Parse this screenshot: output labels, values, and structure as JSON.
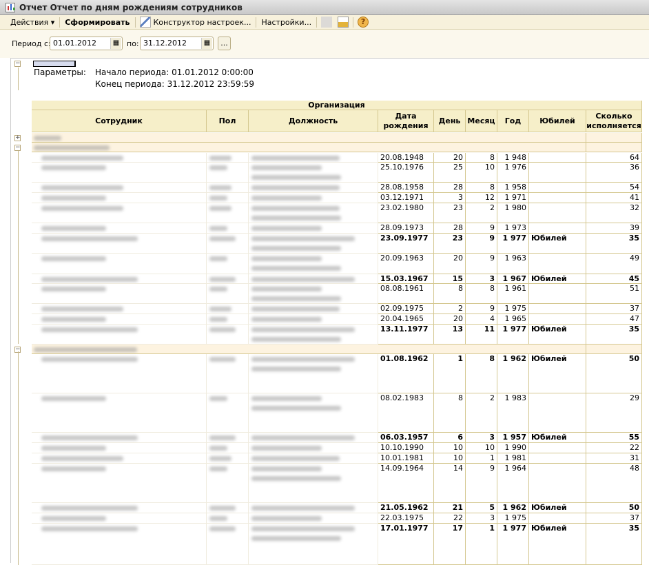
{
  "window": {
    "title": "Отчет  Отчет по дням рождениям сотрудников"
  },
  "toolbar": {
    "actions": "Действия ▾",
    "generate": "Сформировать",
    "constructor": "Конструктор настроек...",
    "settings": "Настройки...",
    "help": "?"
  },
  "period": {
    "from_label": "Период с:",
    "from_value": "01.01.2012",
    "to_label": "по:",
    "to_value": "31.12.2012",
    "more": "..."
  },
  "params": {
    "label": "Параметры:",
    "start": "Начало периода: 01.01.2012 0:00:00",
    "end": "Конец периода: 31.12.2012 23:59:59"
  },
  "table": {
    "group_header": "Организация",
    "columns": [
      "Сотрудник",
      "Пол",
      "Должность",
      "Дата рождения",
      "День",
      "Месяц",
      "Год",
      "Юбилей",
      "Сколько исполняется"
    ],
    "rows": [
      {
        "date": "20.08.1948",
        "day": "20",
        "month": "8",
        "year": "1 948",
        "jubilee": "",
        "age": "64",
        "bold": false
      },
      {
        "date": "25.10.1976",
        "day": "25",
        "month": "10",
        "year": "1 976",
        "jubilee": "",
        "age": "36",
        "bold": false
      },
      {
        "date": "28.08.1958",
        "day": "28",
        "month": "8",
        "year": "1 958",
        "jubilee": "",
        "age": "54",
        "bold": false
      },
      {
        "date": "03.12.1971",
        "day": "3",
        "month": "12",
        "year": "1 971",
        "jubilee": "",
        "age": "41",
        "bold": false
      },
      {
        "date": "23.02.1980",
        "day": "23",
        "month": "2",
        "year": "1 980",
        "jubilee": "",
        "age": "32",
        "bold": false
      },
      {
        "date": "28.09.1973",
        "day": "28",
        "month": "9",
        "year": "1 973",
        "jubilee": "",
        "age": "39",
        "bold": false
      },
      {
        "date": "23.09.1977",
        "day": "23",
        "month": "9",
        "year": "1 977",
        "jubilee": "Юбилей",
        "age": "35",
        "bold": true
      },
      {
        "date": "20.09.1963",
        "day": "20",
        "month": "9",
        "year": "1 963",
        "jubilee": "",
        "age": "49",
        "bold": false
      },
      {
        "date": "15.03.1967",
        "day": "15",
        "month": "3",
        "year": "1 967",
        "jubilee": "Юбилей",
        "age": "45",
        "bold": true
      },
      {
        "date": "08.08.1961",
        "day": "8",
        "month": "8",
        "year": "1 961",
        "jubilee": "",
        "age": "51",
        "bold": false
      },
      {
        "date": "02.09.1975",
        "day": "2",
        "month": "9",
        "year": "1 975",
        "jubilee": "",
        "age": "37",
        "bold": false
      },
      {
        "date": "20.04.1965",
        "day": "20",
        "month": "4",
        "year": "1 965",
        "jubilee": "",
        "age": "47",
        "bold": false
      },
      {
        "date": "13.11.1977",
        "day": "13",
        "month": "11",
        "year": "1 977",
        "jubilee": "Юбилей",
        "age": "35",
        "bold": true
      },
      {
        "group": true
      },
      {
        "date": "01.08.1962",
        "day": "1",
        "month": "8",
        "year": "1 962",
        "jubilee": "Юбилей",
        "age": "50",
        "bold": true
      },
      {
        "date": "08.02.1983",
        "day": "8",
        "month": "2",
        "year": "1 983",
        "jubilee": "",
        "age": "29",
        "bold": false
      },
      {
        "date": "06.03.1957",
        "day": "6",
        "month": "3",
        "year": "1 957",
        "jubilee": "Юбилей",
        "age": "55",
        "bold": true
      },
      {
        "date": "10.10.1990",
        "day": "10",
        "month": "10",
        "year": "1 990",
        "jubilee": "",
        "age": "22",
        "bold": false
      },
      {
        "date": "10.01.1981",
        "day": "10",
        "month": "1",
        "year": "1 981",
        "jubilee": "",
        "age": "31",
        "bold": false
      },
      {
        "date": "14.09.1964",
        "day": "14",
        "month": "9",
        "year": "1 964",
        "jubilee": "",
        "age": "48",
        "bold": false
      },
      {
        "date": "21.05.1962",
        "day": "21",
        "month": "5",
        "year": "1 962",
        "jubilee": "Юбилей",
        "age": "50",
        "bold": true
      },
      {
        "date": "22.03.1975",
        "day": "22",
        "month": "3",
        "year": "1 975",
        "jubilee": "",
        "age": "37",
        "bold": false
      },
      {
        "date": "17.01.1977",
        "day": "17",
        "month": "1",
        "year": "1 977",
        "jubilee": "Юбилей",
        "age": "35",
        "bold": true
      }
    ]
  }
}
